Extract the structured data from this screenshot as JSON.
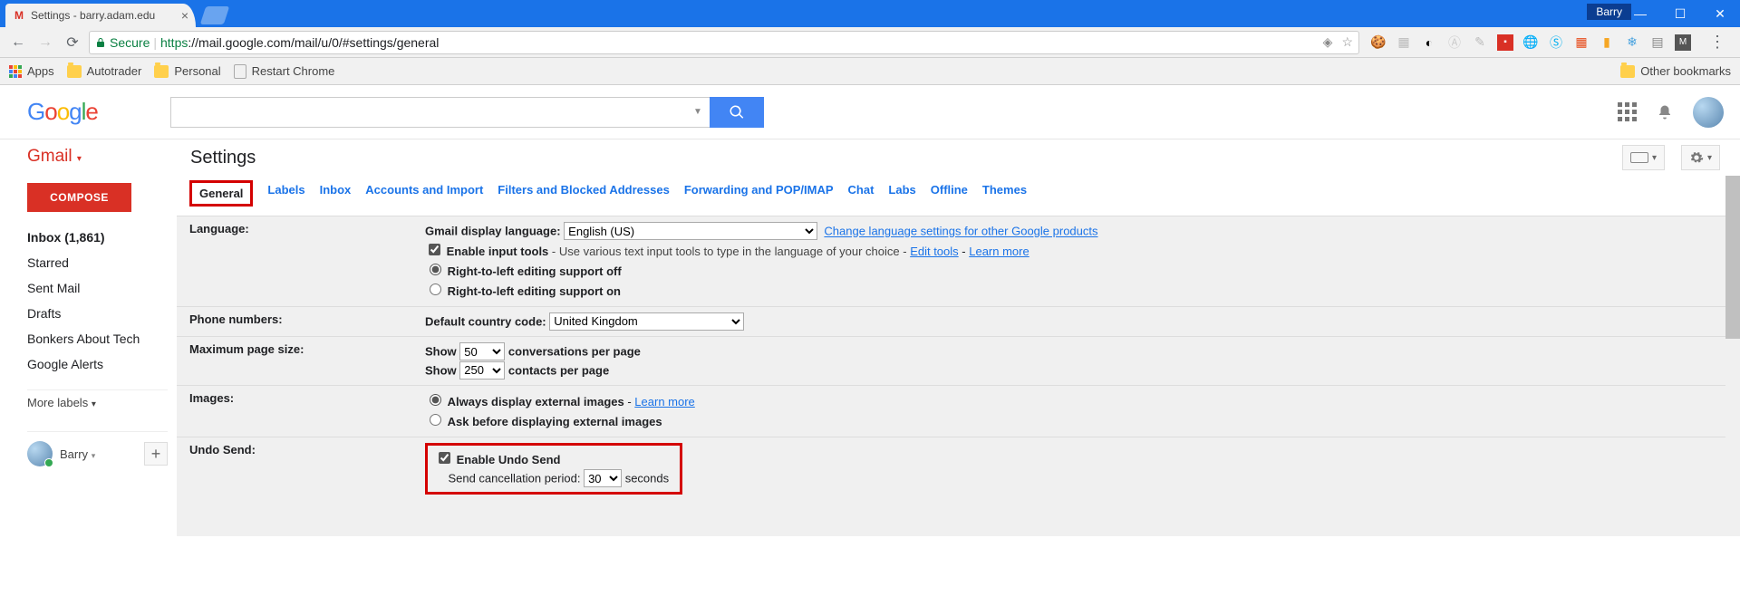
{
  "browser": {
    "tab_title": "Settings - barry.adam.edu",
    "profile_name": "Barry",
    "secure_label": "Secure",
    "url_scheme": "https",
    "url_rest": "://mail.google.com/mail/u/0/#settings/general",
    "bookmarks": {
      "apps": "Apps",
      "items": [
        "Autotrader",
        "Personal",
        "Restart Chrome"
      ],
      "other": "Other bookmarks"
    }
  },
  "gmail": {
    "app_label": "Gmail",
    "settings_title": "Settings",
    "compose": "COMPOSE",
    "nav": {
      "inbox": "Inbox (1,861)",
      "starred": "Starred",
      "sent": "Sent Mail",
      "drafts": "Drafts",
      "bonkers": "Bonkers About Tech",
      "alerts": "Google Alerts",
      "more": "More labels"
    },
    "hangout_name": "Barry",
    "tabs": [
      "General",
      "Labels",
      "Inbox",
      "Accounts and Import",
      "Filters and Blocked Addresses",
      "Forwarding and POP/IMAP",
      "Chat",
      "Labs",
      "Offline",
      "Themes"
    ],
    "language": {
      "label": "Language:",
      "display_label": "Gmail display language:",
      "selected": "English (US)",
      "change_link": "Change language settings for other Google products",
      "enable_tools_label": "Enable input tools",
      "enable_tools_desc": " - Use various text input tools to type in the language of your choice - ",
      "edit_tools": "Edit tools",
      "learn_more": "Learn more",
      "rtl_off": "Right-to-left editing support off",
      "rtl_on": "Right-to-left editing support on"
    },
    "phone": {
      "label": "Phone numbers:",
      "default_label": "Default country code:",
      "selected": "United Kingdom"
    },
    "pagesize": {
      "label": "Maximum page size:",
      "show": "Show",
      "conv_val": "50",
      "conv_suffix": "conversations per page",
      "contacts_val": "250",
      "contacts_suffix": "contacts per page"
    },
    "images": {
      "label": "Images:",
      "always": "Always display external images",
      "learn": "Learn more",
      "ask": "Ask before displaying external images"
    },
    "undo": {
      "label": "Undo Send:",
      "enable": "Enable Undo Send",
      "period_label": "Send cancellation period:",
      "period_val": "30",
      "period_suffix": "seconds"
    }
  }
}
